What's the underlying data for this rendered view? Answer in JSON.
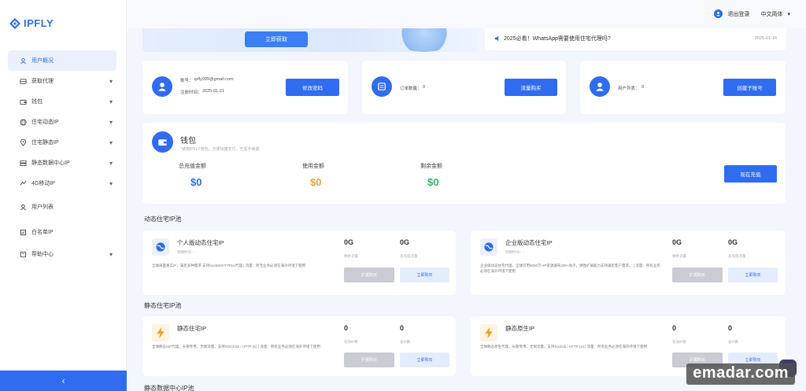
{
  "brand": {
    "name": "IPFLY",
    "color": "#2f6cf0"
  },
  "sidebar": {
    "items": [
      {
        "label": "用户概况",
        "icon": "user-icon",
        "expandable": false,
        "active": true
      },
      {
        "label": "获取代理",
        "icon": "proxy-icon",
        "expandable": true
      },
      {
        "label": "钱包",
        "icon": "wallet-icon",
        "expandable": true
      },
      {
        "label": "住宅动态IP",
        "icon": "globe-icon",
        "expandable": true
      },
      {
        "label": "住宅静态IP",
        "icon": "location-icon",
        "expandable": true
      },
      {
        "label": "静态数据中心IP",
        "icon": "server-icon",
        "expandable": true
      },
      {
        "label": "4G移动IP",
        "icon": "mobile-icon",
        "expandable": true
      },
      {
        "label": "用户列表",
        "icon": "users-icon",
        "expandable": false
      },
      {
        "label": "白名单IP",
        "icon": "whitelist-icon",
        "expandable": false
      },
      {
        "label": "帮助中心",
        "icon": "help-icon",
        "expandable": true
      }
    ],
    "collapse_glyph": "‹"
  },
  "header": {
    "user_label": "退出登录",
    "language": "中文简体"
  },
  "banner": {
    "button_label": "立即获取"
  },
  "notice": {
    "text": "2025必看！WhatsApp需要使用住宅代理吗?",
    "date": "2025-01-16"
  },
  "account": {
    "account_label": "账号：",
    "account_value": "ipfly999@gmail.com",
    "reg_label": "注册时间：",
    "reg_value": "2025-01-21",
    "button": "修改密码"
  },
  "orders": {
    "label": "订单数量：",
    "value": "0",
    "button": "流量购买"
  },
  "subusers": {
    "label": "用户列表：",
    "value": "0",
    "button": "创建子账号"
  },
  "wallet": {
    "title": "钱包",
    "subtitle": "*使用IPFLY钱包，方便快捷支付，无需手续费",
    "stats": [
      {
        "label": "总充值金额",
        "value": "$0",
        "color": "#2f6cf0"
      },
      {
        "label": "使用金额",
        "value": "$0",
        "color": "#f0a23a"
      },
      {
        "label": "剩余金额",
        "value": "$0",
        "color": "#2fb36a"
      }
    ],
    "button": "现在充值"
  },
  "sections": {
    "dynamic": "动态住宅IP池",
    "static": "静态住宅IP池",
    "datacenter": "静态数据中心IP池"
  },
  "products": [
    {
      "name": "个人版动态住宅IP",
      "sub": "到期时间：-",
      "desc": "全球海量真实IP，满足多种需求 支持Socks5/HTTP(s)代理 | 流量：所无业务必须在海外环境下使用",
      "num1": "0G",
      "num1_label": "剩余流量",
      "num2": "0G",
      "num2_label": "总充值流量",
      "btn1": "扩展购买",
      "btn2": "立即购买"
    },
    {
      "name": "企业版动态住宅IP",
      "sub": "到期时间：-",
      "desc": "企业级动态住宅代理，全球可用9000万+IP资源遍布200+地点，弹性扩展能力支持满足客户需求。 | 流量：所有业务必须在海外环境下使用",
      "num1": "0G",
      "num1_label": "剩余流量",
      "num2": "0G",
      "num2_label": "总充值流量",
      "btn1": "扩展购买",
      "btn2": "立即购买"
    },
    {
      "name": "静态住宅IP",
      "sub": "",
      "desc": "全球静态ISP代理，长期专用，无限流量，支持SOCKS5 / HTTP (S) | 流量：所有业务必须在海外环境下使用",
      "num1": "0",
      "num1_label": "有效IP数",
      "num2": "0",
      "num2_label": "总IP数",
      "btn1": "扩展购买",
      "btn2": "立即购买"
    },
    {
      "name": "静态原生IP",
      "sub": "",
      "desc": "全球静态原生代理，长期专用，无限流量，支持Socks5 / HTTP (S) | 流量：所有业务必须在海外环境下使用",
      "num1": "0",
      "num1_label": "有效IP数",
      "num2": "0",
      "num2_label": "总IP数",
      "btn1": "扩展购买",
      "btn2": "立即购买"
    }
  ],
  "watermark": "emadar.com"
}
